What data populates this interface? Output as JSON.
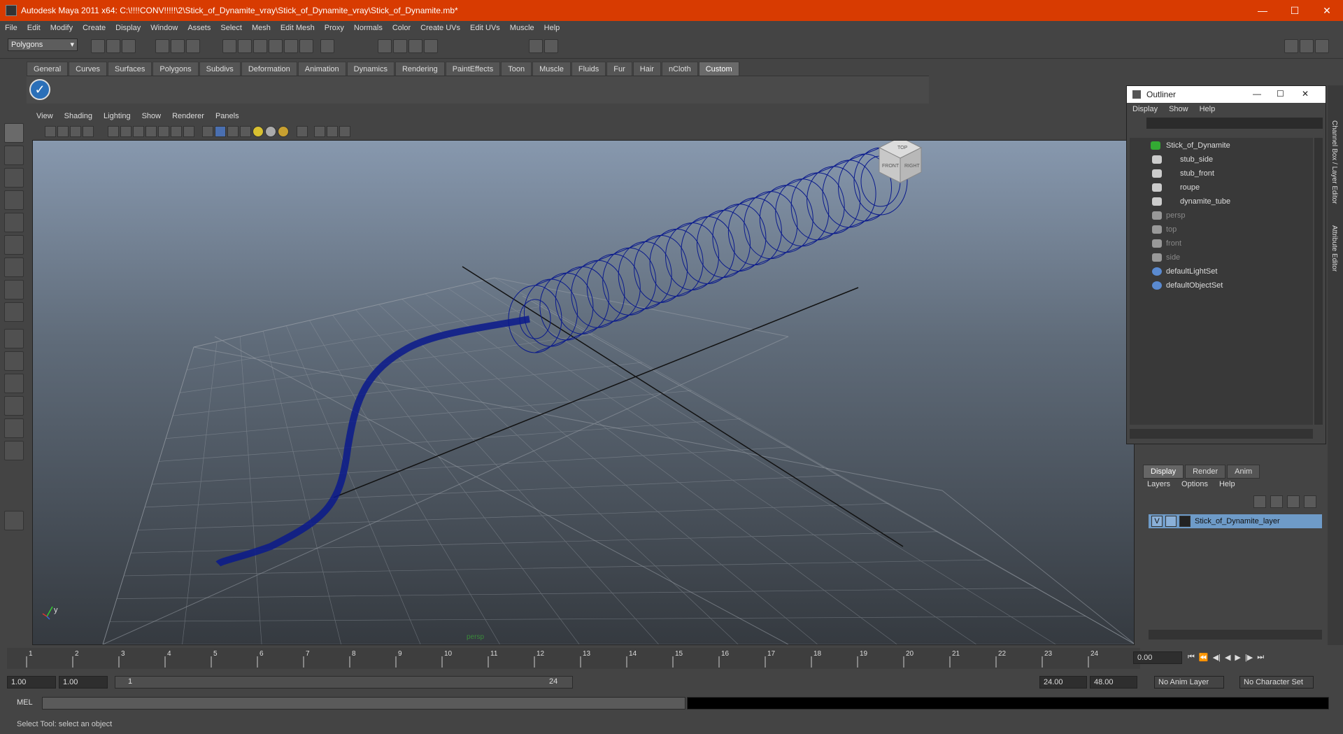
{
  "window": {
    "title": "Autodesk Maya 2011 x64: C:\\!!!!CONV!!!!!\\2\\Stick_of_Dynamite_vray\\Stick_of_Dynamite_vray\\Stick_of_Dynamite.mb*",
    "minimize": "—",
    "maximize": "☐",
    "close": "✕"
  },
  "menubar": [
    "File",
    "Edit",
    "Modify",
    "Create",
    "Display",
    "Window",
    "Assets",
    "Select",
    "Mesh",
    "Edit Mesh",
    "Proxy",
    "Normals",
    "Color",
    "Create UVs",
    "Edit UVs",
    "Muscle",
    "Help"
  ],
  "mode_selector": "Polygons",
  "shelf_tabs": [
    "General",
    "Curves",
    "Surfaces",
    "Polygons",
    "Subdivs",
    "Deformation",
    "Animation",
    "Dynamics",
    "Rendering",
    "PaintEffects",
    "Toon",
    "Muscle",
    "Fluids",
    "Fur",
    "Hair",
    "nCloth",
    "Custom"
  ],
  "active_shelf": "Custom",
  "viewport": {
    "menu": [
      "View",
      "Shading",
      "Lighting",
      "Show",
      "Renderer",
      "Panels"
    ],
    "camera_label": "persp",
    "viewcube": {
      "top": "TOP",
      "front": "FRONT",
      "right": "RIGHT"
    },
    "axis": {
      "x": "x",
      "y": "y"
    },
    "wire_color": "#0a1a8c"
  },
  "timeline": {
    "ticks": [
      "1",
      "2",
      "3",
      "4",
      "5",
      "6",
      "7",
      "8",
      "9",
      "10",
      "11",
      "12",
      "13",
      "14",
      "15",
      "16",
      "17",
      "18",
      "19",
      "20",
      "21",
      "22",
      "23",
      "24"
    ],
    "current_time": "0.00"
  },
  "range": {
    "start": "1.00",
    "playback_start": "1.00",
    "slider_start": "1",
    "slider_end": "24",
    "playback_end": "24.00",
    "end": "48.00",
    "anim_layer": "No Anim Layer",
    "character_set": "No Character Set"
  },
  "mel": {
    "label": "MEL"
  },
  "helpline": "Select Tool: select an object",
  "outliner": {
    "title": "Outliner",
    "menu": [
      "Display",
      "Show",
      "Help"
    ],
    "items": [
      {
        "label": "Stick_of_Dynamite",
        "dim": false
      },
      {
        "label": "stub_side",
        "dim": false
      },
      {
        "label": "stub_front",
        "dim": false
      },
      {
        "label": "roupe",
        "dim": false
      },
      {
        "label": "dynamite_tube",
        "dim": false
      },
      {
        "label": "persp",
        "dim": true
      },
      {
        "label": "top",
        "dim": true
      },
      {
        "label": "front",
        "dim": true
      },
      {
        "label": "side",
        "dim": true
      },
      {
        "label": "defaultLightSet",
        "dim": false
      },
      {
        "label": "defaultObjectSet",
        "dim": false
      }
    ]
  },
  "layer_editor": {
    "tabs": [
      "Display",
      "Render",
      "Anim"
    ],
    "active_tab": "Display",
    "menu": [
      "Layers",
      "Options",
      "Help"
    ],
    "layer": {
      "visible": "V",
      "name": "Stick_of_Dynamite_layer"
    }
  },
  "side_tabs": [
    "Channel Box / Layer Editor",
    "Attribute Editor"
  ]
}
